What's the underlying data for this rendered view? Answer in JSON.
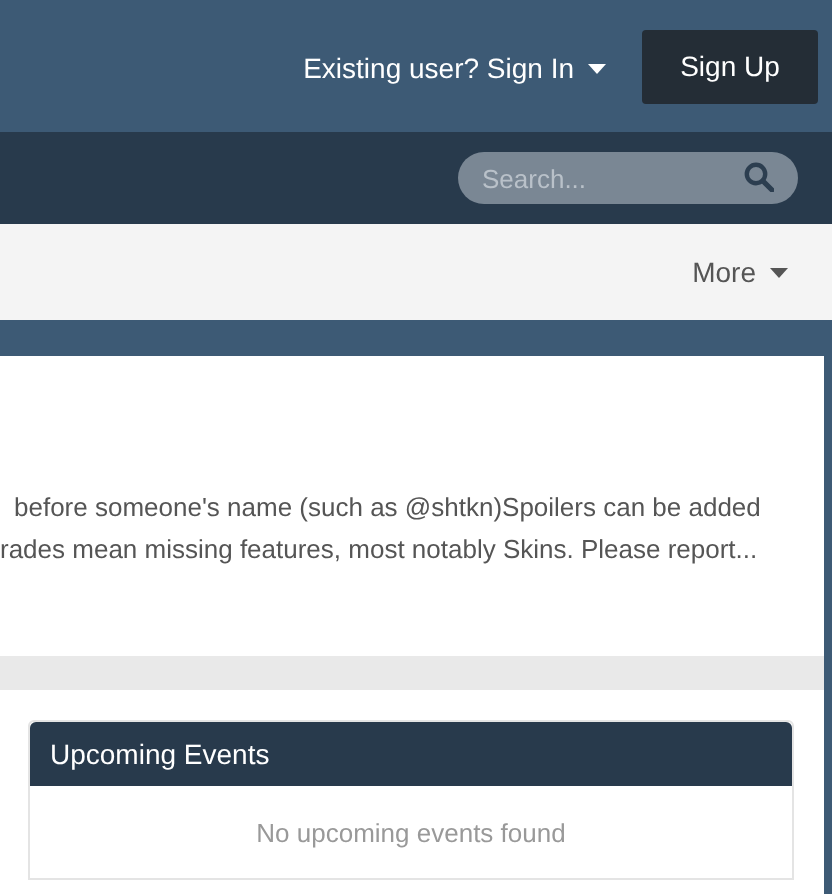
{
  "header": {
    "sign_in": "Existing user? Sign In",
    "sign_up": "Sign Up"
  },
  "search": {
    "placeholder": "Search..."
  },
  "menu": {
    "more": "More"
  },
  "announcement": {
    "lines": [
      "before someone's name (such as @shtkn)Spoilers can be added",
      "rades mean missing features, most notably Skins. Please report..."
    ]
  },
  "widget": {
    "title": "Upcoming Events",
    "empty": "No upcoming events found"
  }
}
